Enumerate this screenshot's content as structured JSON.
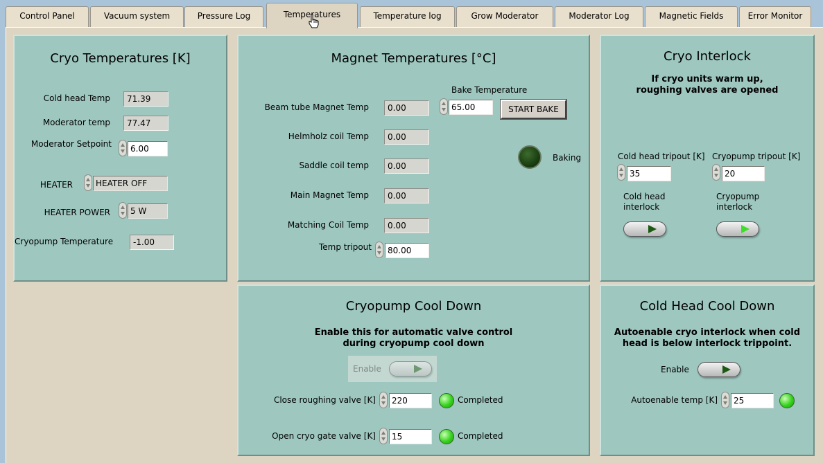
{
  "tabs": [
    {
      "label": "Control Panel"
    },
    {
      "label": "Vacuum system"
    },
    {
      "label": "Pressure Log"
    },
    {
      "label": "Temperatures"
    },
    {
      "label": "Temperature log"
    },
    {
      "label": "Grow Moderator"
    },
    {
      "label": "Moderator Log"
    },
    {
      "label": "Magnetic Fields"
    },
    {
      "label": "Error Monitor"
    }
  ],
  "active_tab": "Temperatures",
  "cryo": {
    "title": "Cryo Temperatures [K]",
    "cold_head_label": "Cold head Temp",
    "cold_head_value": "71.39",
    "moderator_label": "Moderator temp",
    "moderator_value": "77.47",
    "setpoint_label": "Moderator Setpoint",
    "setpoint_value": "6.00",
    "heater_label": "HEATER",
    "heater_value": "HEATER OFF",
    "heater_power_label": "HEATER POWER",
    "heater_power_value": "5 W",
    "cryopump_label": "Cryopump Temperature",
    "cryopump_value": "-1.00"
  },
  "magnet": {
    "title": "Magnet Temperatures [°C]",
    "bake_label": "Bake Temperature",
    "bake_value": "65.00",
    "start_bake_label": "START BAKE",
    "baking_label": "Baking",
    "rows": [
      {
        "label": "Beam tube Magnet Temp",
        "value": "0.00"
      },
      {
        "label": "Helmholz coil Temp",
        "value": "0.00"
      },
      {
        "label": "Saddle coil temp",
        "value": "0.00"
      },
      {
        "label": "Main Magnet Temp",
        "value": "0.00"
      },
      {
        "label": "Matching Coil Temp",
        "value": "0.00"
      }
    ],
    "tripout_label": "Temp tripout",
    "tripout_value": "80.00"
  },
  "interlock": {
    "title": "Cryo Interlock",
    "desc_line1": "If cryo units warm up,",
    "desc_line2": "roughing valves are opened",
    "cold_head_tripout_label": "Cold head tripout [K]",
    "cold_head_tripout_value": "35",
    "cryopump_tripout_label": "Cryopump tripout [K]",
    "cryopump_tripout_value": "20",
    "cold_head_interlock_line1": "Cold head",
    "cold_head_interlock_line2": "interlock",
    "cryopump_interlock_line1": "Cryopump",
    "cryopump_interlock_line2": "interlock"
  },
  "cooldown": {
    "title": "Cryopump Cool Down",
    "desc_line1": "Enable this for automatic valve control",
    "desc_line2": "during cryopump cool down",
    "enable_label": "Enable",
    "close_label": "Close roughing valve [K]",
    "close_value": "220",
    "close_status": "Completed",
    "open_label": "Open cryo gate valve [K]",
    "open_value": "15",
    "open_status": "Completed"
  },
  "coldhead": {
    "title": "Cold Head Cool Down",
    "desc_line1": "Autoenable cryo interlock when cold",
    "desc_line2": "head is below interlock trippoint.",
    "enable_label": "Enable",
    "autoenable_label": "Autoenable temp [K]",
    "autoenable_value": "25"
  },
  "colors": {
    "panel": "#9ec7bf",
    "background": "#ddd4c2",
    "led_on": "#35d21c",
    "led_off": "#173b10"
  }
}
